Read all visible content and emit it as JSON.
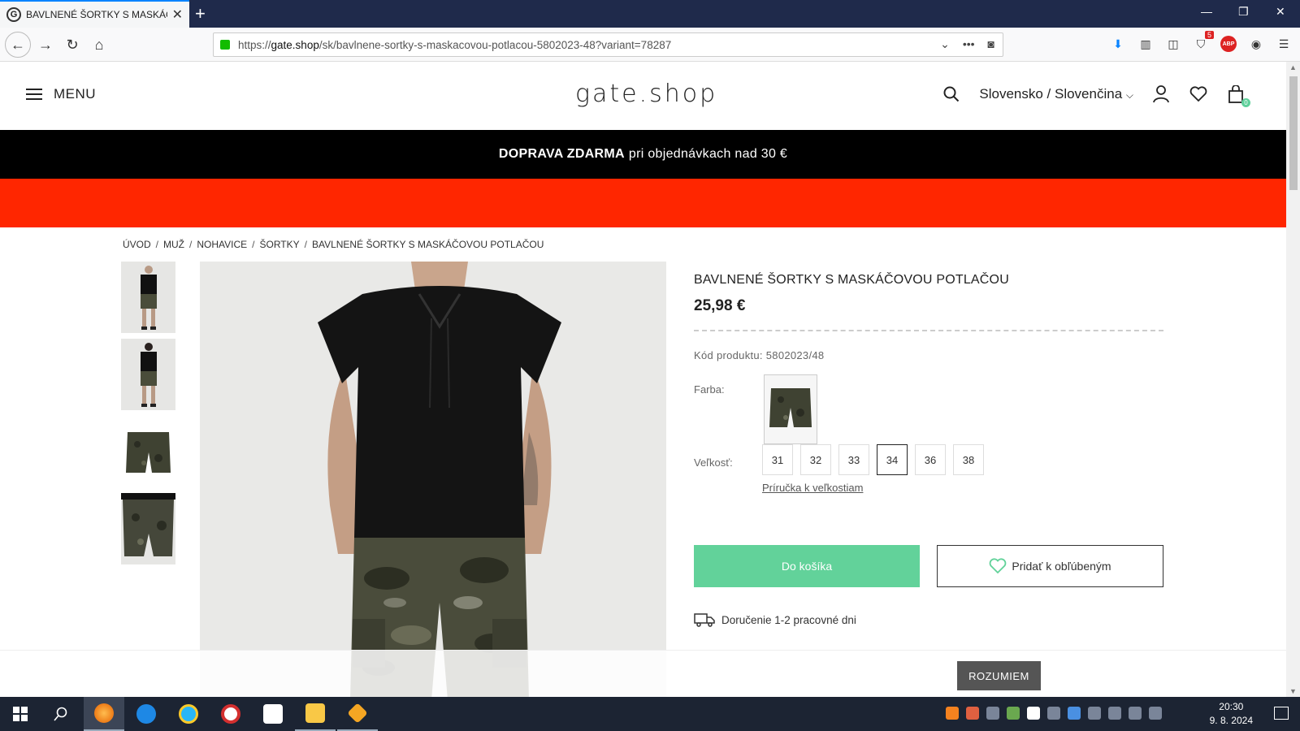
{
  "browser": {
    "tab_title": "BAVLNENÉ ŠORTKY S MASKÁČ",
    "url_prefix": "https://",
    "url_host": "gate.shop",
    "url_path": "/sk/bavlnene-sortky-s-maskacovou-potlacou-5802023-48?variant=78287",
    "ext_badge": "5",
    "abp_label": "ABP"
  },
  "header": {
    "menu_label": "MENU",
    "logo": "gate.shop",
    "locale": "Slovensko / Slovenčina",
    "cart_count": "0"
  },
  "promo": {
    "bold": "DOPRAVA ZDARMA",
    "rest": "pri objednávkach nad 30 €"
  },
  "breadcrumb": [
    "ÚVOD",
    "MUŽ",
    "NOHAVICE",
    "ŠORTKY",
    "BAVLNENÉ ŠORTKY S MASKÁČOVOU POTLAČOU"
  ],
  "product": {
    "title": "BAVLNENÉ ŠORTKY S MASKÁČOVOU POTLAČOU",
    "price": "25,98 €",
    "code": "Kód produktu: 5802023/48",
    "color_label": "Farba:",
    "size_label": "Veľkosť:",
    "sizes": [
      "31",
      "32",
      "33",
      "34",
      "36",
      "38"
    ],
    "selected_size": "34",
    "size_guide": "Príručka k veľkostiam",
    "add_to_cart": "Do košíka",
    "add_to_fav": "Pridať k obľúbeným",
    "delivery": "Doručenie 1-2 pracovné dni"
  },
  "cookie": {
    "button": "ROZUMIEM"
  },
  "taskbar": {
    "time": "20:30",
    "date": "9. 8. 2024"
  },
  "colors": {
    "promo_bg": "#000000",
    "red_bar": "#ff2600",
    "cart_button": "#62d29a",
    "firefox_tab_accent": "#0a84ff"
  }
}
